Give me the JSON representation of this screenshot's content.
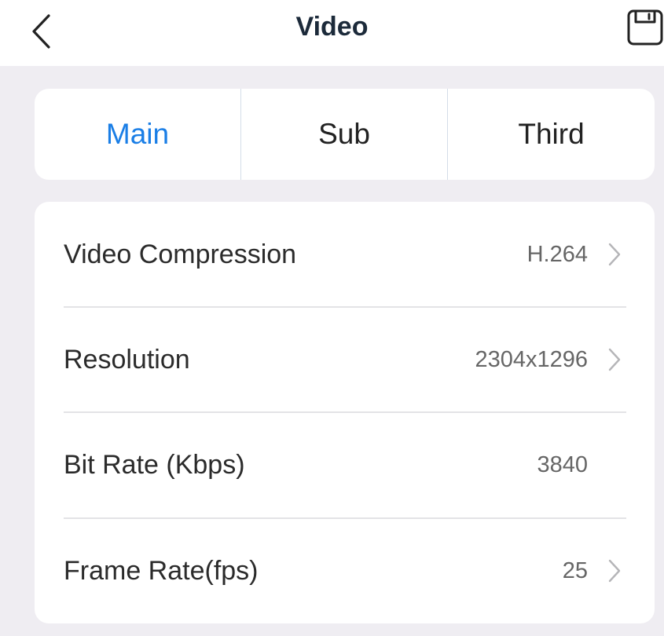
{
  "header": {
    "title": "Video",
    "back_icon": "chevron-left-icon",
    "save_icon": "save-icon"
  },
  "tabs": [
    {
      "label": "Main",
      "active": true
    },
    {
      "label": "Sub",
      "active": false
    },
    {
      "label": "Third",
      "active": false
    }
  ],
  "settings": [
    {
      "label": "Video Compression",
      "value": "H.264",
      "has_chevron": true
    },
    {
      "label": "Resolution",
      "value": "2304x1296",
      "has_chevron": true
    },
    {
      "label": "Bit Rate (Kbps)",
      "value": "3840",
      "has_chevron": false
    },
    {
      "label": "Frame Rate(fps)",
      "value": "25",
      "has_chevron": true
    }
  ],
  "colors": {
    "accent": "#1a7ee6",
    "background": "#efedf2",
    "title": "#1c2a3a"
  }
}
